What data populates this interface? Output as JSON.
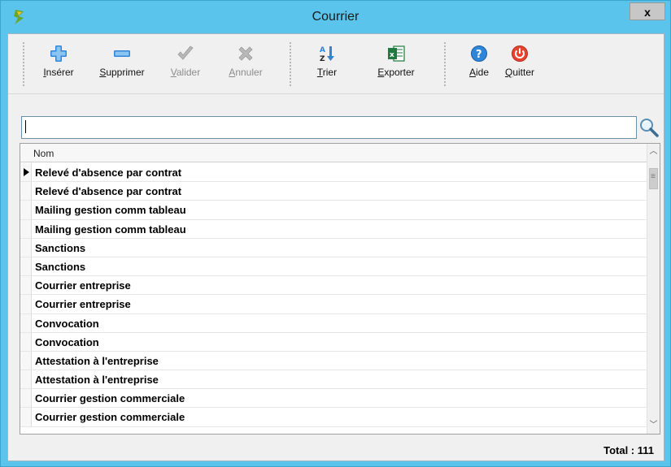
{
  "window": {
    "title": "Courrier",
    "close_label": "x"
  },
  "toolbar": {
    "buttons": [
      {
        "label": "Insérer",
        "accel": "I",
        "rest": "nsérer",
        "icon": "plus-icon",
        "enabled": true
      },
      {
        "label": "Supprimer",
        "accel": "S",
        "rest": "upprimer",
        "icon": "minus-icon",
        "enabled": true
      },
      {
        "label": "Valider",
        "accel": "V",
        "rest": "alider",
        "icon": "checkmark-icon",
        "enabled": false
      },
      {
        "label": "Annuler",
        "accel": "A",
        "rest": "nnuler",
        "icon": "cross-icon",
        "enabled": false
      },
      {
        "label": "Trier",
        "accel": "T",
        "rest": "rier",
        "icon": "sort-az-icon",
        "enabled": true
      },
      {
        "label": "Exporter",
        "accel": "E",
        "rest": "xporter",
        "icon": "excel-icon",
        "enabled": true
      },
      {
        "label": "Aide",
        "accel": "A",
        "rest": "ide",
        "icon": "help-icon",
        "enabled": true
      },
      {
        "label": "Quitter",
        "accel": "Q",
        "rest": "uitter",
        "icon": "power-icon",
        "enabled": true
      }
    ]
  },
  "search": {
    "value": "",
    "icon": "magnifier-icon"
  },
  "grid": {
    "column_header": "Nom",
    "selected_index": 0,
    "rows": [
      "Relevé d'absence par contrat",
      "Relevé d'absence par contrat",
      "Mailing gestion comm tableau",
      "Mailing gestion comm tableau",
      "Sanctions",
      "Sanctions",
      "Courrier entreprise",
      "Courrier entreprise",
      "Convocation",
      "Convocation",
      "Attestation à l'entreprise",
      "Attestation à l'entreprise",
      "Courrier gestion commerciale",
      "Courrier gestion commerciale"
    ]
  },
  "status": {
    "total": "Total : 111"
  },
  "colors": {
    "titlebar": "#5bc4ec",
    "client_bg": "#f0f0f0",
    "plus_blue": "#2f86d9",
    "power_red": "#e8432e",
    "excel_green": "#1e7a3e"
  }
}
